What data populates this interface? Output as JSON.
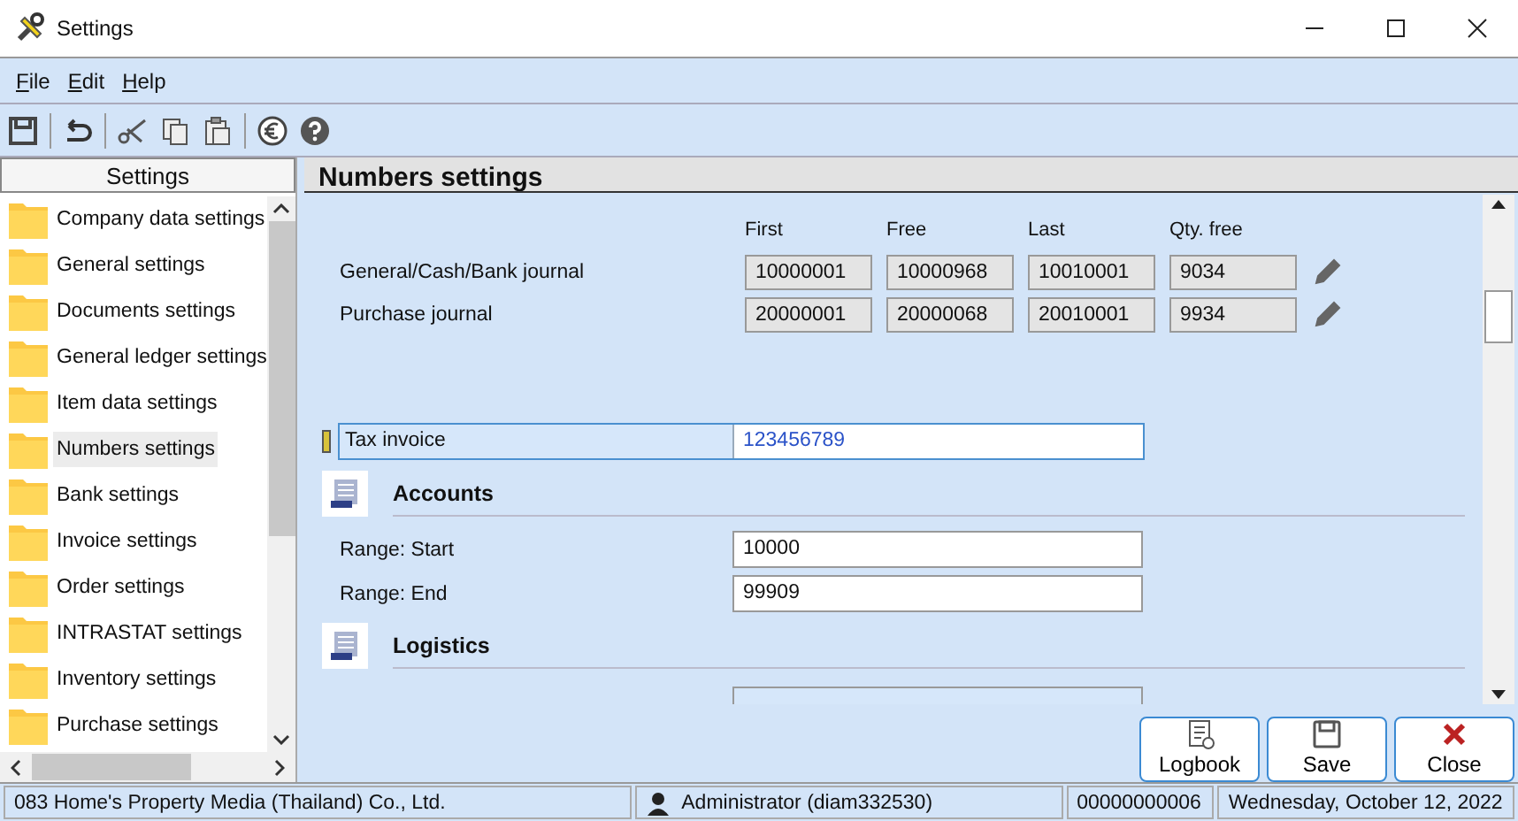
{
  "window": {
    "title": "Settings"
  },
  "menu": [
    "File",
    "Edit",
    "Help"
  ],
  "sidebar": {
    "title": "Settings",
    "items": [
      {
        "label": "Company data settings",
        "selected": false
      },
      {
        "label": "General settings",
        "selected": false
      },
      {
        "label": "Documents settings",
        "selected": false
      },
      {
        "label": "General ledger settings",
        "selected": false
      },
      {
        "label": "Item data settings",
        "selected": false
      },
      {
        "label": "Numbers settings",
        "selected": true
      },
      {
        "label": "Bank settings",
        "selected": false
      },
      {
        "label": "Invoice settings",
        "selected": false
      },
      {
        "label": "Order settings",
        "selected": false
      },
      {
        "label": "INTRASTAT settings",
        "selected": false
      },
      {
        "label": "Inventory settings",
        "selected": false
      },
      {
        "label": "Purchase settings",
        "selected": false
      }
    ]
  },
  "panel": {
    "title": "Numbers settings",
    "columns": [
      "First",
      "Free",
      "Last",
      "Qty. free"
    ],
    "journals": [
      {
        "name": "General/Cash/Bank journal",
        "values": [
          "10000001",
          "10000968",
          "10010001",
          "9034"
        ]
      },
      {
        "name": "Purchase journal",
        "values": [
          "20000001",
          "20000068",
          "20010001",
          "9934"
        ]
      }
    ],
    "tax_invoice": {
      "label": "Tax invoice",
      "value": "123456789"
    },
    "sections": [
      {
        "title": "Accounts",
        "fields": [
          {
            "label": "Range: Start",
            "value": "10000"
          },
          {
            "label": "Range: End",
            "value": "99909"
          }
        ]
      },
      {
        "title": "Logistics"
      }
    ]
  },
  "buttons": [
    {
      "kind": "logbook",
      "label": "Logbook"
    },
    {
      "kind": "save",
      "label": "Save"
    },
    {
      "kind": "close",
      "label": "Close"
    }
  ],
  "status_bar": {
    "company": "083 Home's Property Media (Thailand) Co., Ltd.",
    "user": "Administrator (diam332530)",
    "number": "00000000006",
    "date": "Wednesday, October 12, 2022"
  }
}
